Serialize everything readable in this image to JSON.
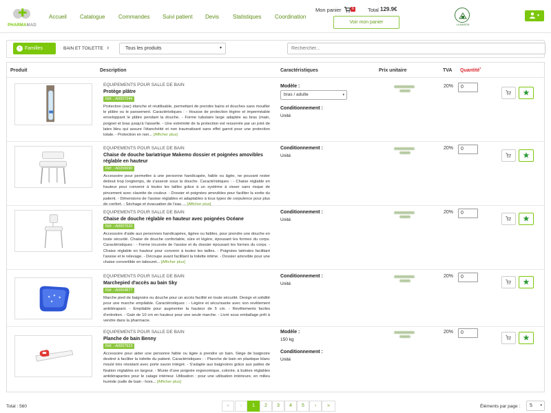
{
  "header": {
    "logo_text_1": "PHARMA",
    "logo_text_2": "MAD",
    "nav": [
      "Accueil",
      "Catalogue",
      "Commandes",
      "Suivi patient",
      "Devis",
      "Statistiques",
      "Coordination"
    ],
    "cart_label": "Mon panier",
    "cart_count": "6",
    "total_label": "Total",
    "total_value": "129.9€",
    "view_cart_label": "Voir mon panier",
    "brand2_text": "LA MAISON"
  },
  "filters": {
    "familles_label": "Familles",
    "breadcrumb": "BAIN ET TOILETTE",
    "product_select": "Tous les produits",
    "search_placeholder": "Rechercher..."
  },
  "table": {
    "headers": {
      "produit": "Produit",
      "description": "Description",
      "caracteristiques": "Caractéristiques",
      "prix": "Prix unitaire",
      "tva": "TVA",
      "quantite": "Quantité",
      "required": "*"
    },
    "rows": [
      {
        "category": "EQUIPEMENTS POUR SALLE DE BAIN",
        "name": "Protège plâtre",
        "ref": "Réf. : A0007344",
        "description": "Protection (sac) étanche et réutilisable, permettant de prendre bains et douches sans mouiller le plâtre ou le pansement. Caractéristiques : - Housse de protection légère et imperméable enveloppant le plâtre pendant la douche. - Forme tubulaire large adaptée au bras (main, poignet et bras jusqu'à l'aisselle. - Une extrémité de la protection est resserrée par un joint de latex bleu qui assure l'étanchéité et non traumatisant sans effet garrot pour une protection totale. - Protection en non...",
        "more": "[Afficher plus]",
        "model_label": "Modèle :",
        "model_value": "bras / adulte",
        "cond_label": "Conditionnement :",
        "cond_value": "Unité",
        "tva": "20%",
        "qty": "0"
      },
      {
        "category": "EQUIPEMENTS POUR SALLE DE BAIN",
        "name": "Chaise de douche bariatrique Makemo dossier et poignées amovibles réglable en hauteur",
        "ref": "Réf. : A0206690",
        "description": "Accessoire pour permettre à une personne handicapée, faible ou âgée, ne pouvant rester debout trop longtemps, de s'asseoir sous la douche. Caractéristiques : - Chaise réglable en hauteur pour convenir à toutes les tailles grâce à un système à visser sans risque de pincement avec clavette de couleur. - Dossier et poignées amovibles pour faciliter la sortie du patient. - Dimensions de l'assise réglables et adaptables à tous types de corpulence pour plus de confort. - Séchage et évacuation de l'eau ...",
        "more": "[Afficher plus]",
        "cond_label": "Conditionnement :",
        "cond_value": "Unité",
        "tva": "20%",
        "qty": "0"
      },
      {
        "category": "EQUIPEMENTS POUR SALLE DE BAIN",
        "name": "Chaise de douche réglable en hauteur avec poignées Océane",
        "ref": "Réf. : A0007520",
        "description": "Accessoire d'aide aux personnes handicapées, âgées ou faibles, pour prendre une douche en toute sécurité. Chaise de douche confortable, sûre et légère, épousant les formes du corps. Caractéristiques : - Forme incurvée de l'assise et du dossier épousant les formes du corps. - Chaise réglable en hauteur pour convenir à toutes les tailles. - Poignées latérales facilitant l'assise et le relevage. - Découpe avant facilitant la toilette intime. - Dossier amovible pour une chaise convertible en tabouret...",
        "more": "[Afficher plus]",
        "cond_label": "Conditionnement :",
        "cond_value": "Unité",
        "tva": "20%",
        "qty": "0"
      },
      {
        "category": "EQUIPEMENTS POUR SALLE DE BAIN",
        "name": "Marchepied d'accès au bain Sky",
        "ref": "Réf. : A0004877",
        "description": "Marche pied de baignoire ou douche pour un accès facilité en toute sécurité. Design et solidité pour une marche empilable. Caractéristiques : - Légère et sécurisante avec son revêtement antidérapant. - Empilable pour augmenter la hauteur de 5 cm. - Revêtements faciles d'entretien. - Gain de 10 cm en hauteur pour une seule marche. - Livré sous emballage prêt à vendre dans la pharmacie.",
        "more": "",
        "cond_label": "Conditionnement :",
        "cond_value": "Unité",
        "tva": "20%",
        "qty": "0"
      },
      {
        "category": "EQUIPEMENTS POUR SALLE DE BAIN",
        "name": "Planche de bain Benny",
        "ref": "Réf. : A0007923",
        "description": "Accessoire pour aider une personne faible ou âgée à prendre un bain. Siège de baignoire destiné à faciliter la toilette du patient. Caractéristiques : - Planche de bain en plastique blanc moulé très résistant avec porte savon intégré. - S'adapte aux baignoires grâce aux pattes de fixation réglables en largeur. - Munie d'une poignée ergonomique, colorée, à butées réglables antidérapantes pour le calage intérieur. Utilisation : pour une utilisation intérieure, en milieu humide (salle de bain - hors...",
        "more": "[Afficher plus]",
        "model_label": "Modèle :",
        "model_text": "150 kg",
        "cond_label": "Conditionnement :",
        "cond_value": "Unité",
        "tva": "20%",
        "qty": "0"
      }
    ]
  },
  "footer": {
    "total": "Total : 560",
    "pages": [
      "1",
      "2",
      "3",
      "4",
      "5"
    ],
    "first": "«",
    "prev": "‹",
    "next": "›",
    "last": "»",
    "per_page_label": "Éléments par page :",
    "per_page_value": "5"
  },
  "colors": {
    "accent": "#7cc70b",
    "link": "#5e8d16",
    "badge": "#d9262f"
  }
}
